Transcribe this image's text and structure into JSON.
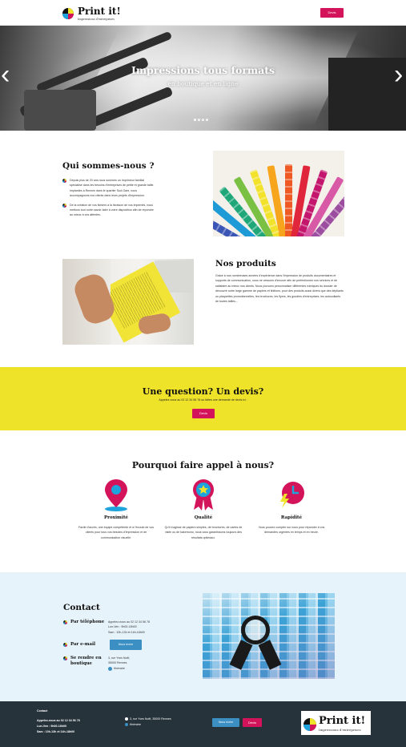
{
  "header": {
    "logo_title": "Print it!",
    "logo_subtitle": "Impressions d'entreprises",
    "devis_button": "Devis"
  },
  "hero": {
    "title": "Impressions tous formats",
    "subtitle": "en boutique et en ligne",
    "prev_icon": "chevron-left-icon",
    "next_icon": "chevron-right-icon",
    "slides_count": 4,
    "active_slide": 1
  },
  "about": {
    "title": "Qui sommes-nous ?",
    "paragraph1": "Depuis plus de 20 ans nous sommes un imprimeur familial spécialisé dans les besoins d'entreprises de petite et grande taille. Implantés à Rennes dans le quartier Sud-Gare, nous accompagnons nos clients dans leurs projets d'impression.",
    "paragraph2": "De la création de vos fichiers à la livraison de vos imprimés, nous mettons tout notre savoir-faire à votre disposition afin de répondre au mieux à vos attentes."
  },
  "products": {
    "title": "Nos produits",
    "paragraph": "Grâce à nos nombreuses années d'expérience dans l'impression de produits documentaires et supports de communication, nous ne cessons d'innover afin de perfectionner nos services et de satisfaire au mieux nos clients. Nous pouvons personnaliser différentes rubriques du dossier de découvrir notre large gamme de papiers et finitions, pour des produits aussi divers que des dépliants ou plaquettes promotionnelles, les brochures, les flyers, les goodies d'entreprises, les autocollants de toutes tailles..."
  },
  "question": {
    "title": "Une question? Un devis?",
    "text": "Appelez-nous au 02 12 34 56 78 ou faites une demande de devis ici :",
    "button": "Devis"
  },
  "why": {
    "title": "Pourquoi faire appel à nous?",
    "features": [
      {
        "icon": "map-pin-icon",
        "title": "Proximité",
        "text": "Facile d'accès, une équipe compétente et à l'écoute de vos clients pour tous vos besoins d'impression et de communication visuelle."
      },
      {
        "icon": "award-ribbon-icon",
        "title": "Qualité",
        "text": "Qu'il s'agisse de papiers simples, de brochures, de cartes de visite ou de kakemono, nous vous garantissons toujours des résultats optimaux."
      },
      {
        "icon": "clock-lightning-icon",
        "title": "Rapidité",
        "text": "Vous pouvez compter sur nous pour répondre à vos demandes urgentes en temps et en heure."
      }
    ]
  },
  "contact": {
    "title": "Contact",
    "phone_label": "Par téléphone",
    "phone_lines": [
      "Appelez-nous au 02 12 34 56 78",
      "Lun-Ven : 9h00-18h00",
      "Sam : 10h-13h et 14h-18h00"
    ],
    "email_label": "Par e-mail",
    "email_button": "Nous écrire",
    "visit_label": "Se rendre en boutique",
    "address_lines": [
      "3, rue Yves Noël,",
      "35000 Rennes"
    ],
    "map_link": "Itinéraire"
  },
  "footer": {
    "heading": "Contact",
    "phone": "Appelez-nous au 02 12 34 56 78",
    "hours1": "Lun-Ven : 9h00-18h00",
    "hours2": "Sam : 10h-13h et 14h-18h00",
    "address": "3, rue Yves Noël, 35000 Rennes",
    "map_link": "Itinéraire",
    "email_button": "Nous écrire",
    "devis_button": "Devis",
    "logo_title": "Print it!",
    "logo_subtitle": "Impressions d'entreprises"
  },
  "colors": {
    "pink": "#d4145a",
    "yellow": "#efe32a",
    "light_blue": "#e7f3fa",
    "footer_dark": "#26333b",
    "button_blue": "#3b8fc3"
  }
}
